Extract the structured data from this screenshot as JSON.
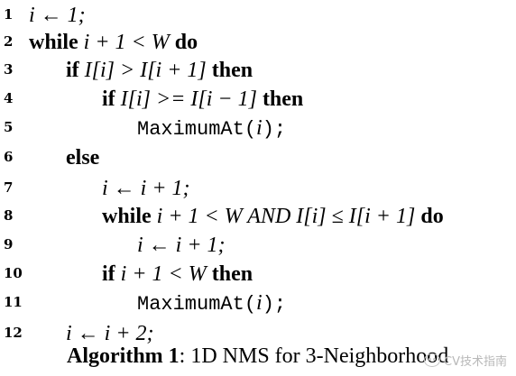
{
  "algorithm": {
    "lines": [
      {
        "num": "1",
        "parts": [
          {
            "t": "i ← 1;",
            "c": "math"
          }
        ]
      },
      {
        "num": "2",
        "parts": [
          {
            "t": "while",
            "c": "kw"
          },
          {
            "t": " i + 1 < W ",
            "c": "math"
          },
          {
            "t": "do",
            "c": "kw"
          }
        ]
      },
      {
        "num": "3",
        "parts": [
          {
            "t": "if",
            "c": "kw"
          },
          {
            "t": " I[i] > I[i + 1] ",
            "c": "math"
          },
          {
            "t": "then",
            "c": "kw"
          }
        ]
      },
      {
        "num": "4",
        "parts": [
          {
            "t": "if",
            "c": "kw"
          },
          {
            "t": " I[i] >= I[i − 1] ",
            "c": "math"
          },
          {
            "t": "then",
            "c": "kw"
          }
        ]
      },
      {
        "num": "5",
        "parts": [
          {
            "t": "MaximumAt(",
            "c": "mono"
          },
          {
            "t": "i",
            "c": "math"
          },
          {
            "t": ");",
            "c": "mono"
          }
        ]
      },
      {
        "num": "6",
        "parts": [
          {
            "t": "else",
            "c": "kw"
          }
        ]
      },
      {
        "num": "7",
        "parts": [
          {
            "t": "i ← i + 1;",
            "c": "math"
          }
        ]
      },
      {
        "num": "8",
        "parts": [
          {
            "t": "while",
            "c": "kw"
          },
          {
            "t": " i + 1 < W AND I[i] ≤ I[i + 1] ",
            "c": "math"
          },
          {
            "t": "do",
            "c": "kw"
          }
        ]
      },
      {
        "num": "9",
        "parts": [
          {
            "t": "i ← i + 1;",
            "c": "math"
          }
        ]
      },
      {
        "num": "10",
        "parts": [
          {
            "t": "if",
            "c": "kw"
          },
          {
            "t": " i + 1 < W ",
            "c": "math"
          },
          {
            "t": "then",
            "c": "kw"
          }
        ]
      },
      {
        "num": "11",
        "parts": [
          {
            "t": "MaximumAt(",
            "c": "mono"
          },
          {
            "t": "i",
            "c": "math"
          },
          {
            "t": ");",
            "c": "mono"
          }
        ]
      },
      {
        "num": "12",
        "parts": [
          {
            "t": "i ← i + 2;",
            "c": "math"
          }
        ]
      }
    ]
  },
  "caption": {
    "label": "Algorithm 1",
    "text": ": 1D NMS for 3-Neighborhood"
  },
  "watermark": {
    "text": "CV技术指南"
  }
}
